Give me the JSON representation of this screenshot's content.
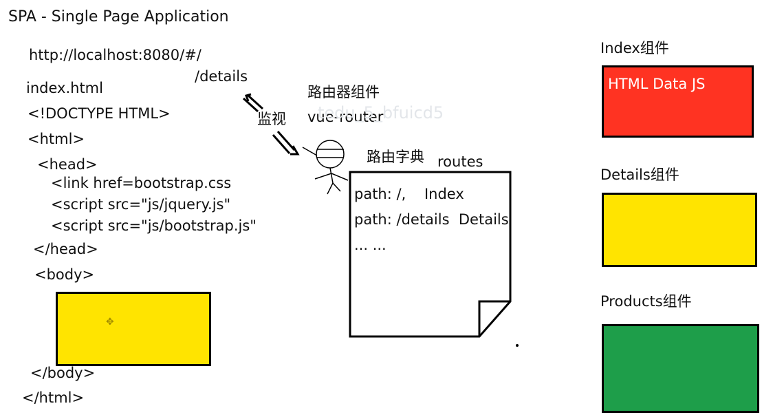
{
  "title": "SPA - Single Page Application",
  "url": "http://localhost:8080/#/",
  "hash_path": "/details",
  "watch_label": "监视",
  "router": {
    "title": "路由器组件",
    "name": "vue-router"
  },
  "routes": {
    "title": "路由字典",
    "name": "routes",
    "entries": [
      "path: /,    Index",
      "path: /details  Details",
      "... ..."
    ]
  },
  "code_lines": [
    "index.html",
    "<!DOCTYPE HTML>",
    "<html>",
    "<head>",
    "<link href=bootstrap.css",
    "<script src=\"js/jquery.js\"",
    "<script src=\"js/bootstrap.js\"",
    "</head>",
    "<body>",
    "</body>",
    "</html>"
  ],
  "components": [
    {
      "label": "Index组件",
      "content": "HTML Data JS",
      "color": "#ff3322"
    },
    {
      "label": "Details组件",
      "content": "",
      "color": "#ffe400"
    },
    {
      "label": "Products组件",
      "content": "",
      "color": "#1e9e4a"
    }
  ],
  "body_box_color": "#ffe400",
  "watermark": "tedu_5_bfuicd5"
}
